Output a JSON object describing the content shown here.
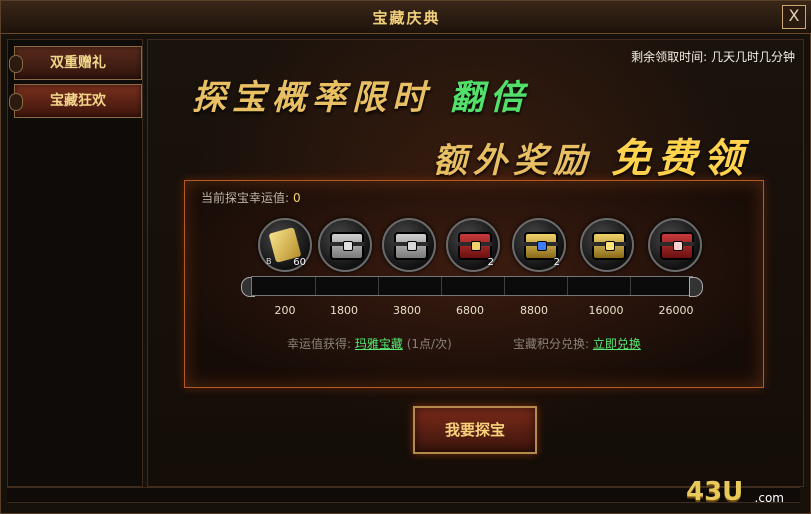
{
  "window": {
    "title": "宝藏庆典",
    "close_label": "X"
  },
  "sidebar": {
    "items": [
      {
        "label": "双重赠礼",
        "active": false
      },
      {
        "label": "宝藏狂欢",
        "active": true
      }
    ]
  },
  "header": {
    "time_label": "剩余领取时间:",
    "time_value": "几天几时几分钟",
    "line1_prefix": "探宝概率限时",
    "line1_highlight": "翻倍",
    "line2_prefix": "额外奖励",
    "line2_highlight": "免费领"
  },
  "panel": {
    "luck_label": "当前探宝幸运值:",
    "luck_value": "0",
    "progress_fraction": 0,
    "items": [
      {
        "icon": "scroll-icon",
        "count": "60",
        "tag": "B"
      },
      {
        "icon": "silver-chest-icon",
        "count": ""
      },
      {
        "icon": "silver-chest-icon",
        "count": ""
      },
      {
        "icon": "red-chest-icon",
        "count": "2"
      },
      {
        "icon": "blue-chest-icon",
        "count": "2"
      },
      {
        "icon": "gold-chest-icon",
        "count": ""
      },
      {
        "icon": "red-chest-icon",
        "count": ""
      }
    ],
    "thresholds": [
      "200",
      "1800",
      "3800",
      "6800",
      "8800",
      "16000",
      "26000"
    ],
    "luck_gain_label": "幸运值获得:",
    "luck_gain_link": "玛雅宝藏",
    "luck_gain_rate": "(1点/次)",
    "points_label": "宝藏积分兑换:",
    "points_link": "立即兑换"
  },
  "actions": {
    "main_button": "我要探宝"
  },
  "branding": {
    "logo_main": "43U",
    "logo_small": ".com"
  },
  "colors": {
    "accent_gold": "#f1cf7a",
    "link_green": "#58ea73",
    "panel_border": "#b55a1f"
  }
}
